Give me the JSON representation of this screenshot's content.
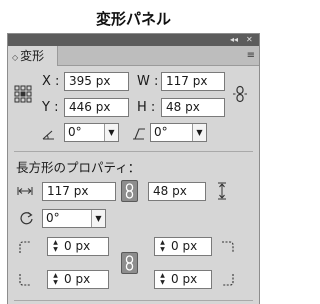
{
  "caption": "変形パネル",
  "titlebar": {
    "collapse": "◂◂",
    "close": "✕"
  },
  "tab": {
    "label": "変形",
    "arrow": "◇"
  },
  "menu_icon": "≡",
  "position": {
    "x_label": "X :",
    "x_value": "395 px",
    "y_label": "Y :",
    "y_value": "446 px",
    "w_label": "W :",
    "w_value": "117 px",
    "h_label": "H :",
    "h_value": "48 px"
  },
  "angles": {
    "rotate_value": "0°",
    "shear_value": "0°"
  },
  "rect_props": {
    "heading": "長方形のプロパティ：",
    "width_value": "117 px",
    "height_value": "48 px",
    "rotation_value": "0°",
    "corner_tl": "0 px",
    "corner_tr": "0 px",
    "corner_bl": "0 px",
    "corner_br": "0 px"
  },
  "icons": {
    "ref_point": "reference-point-grid-icon",
    "link": "chain-link-icon",
    "rotate": "rotate-icon",
    "shear": "shear-icon"
  }
}
